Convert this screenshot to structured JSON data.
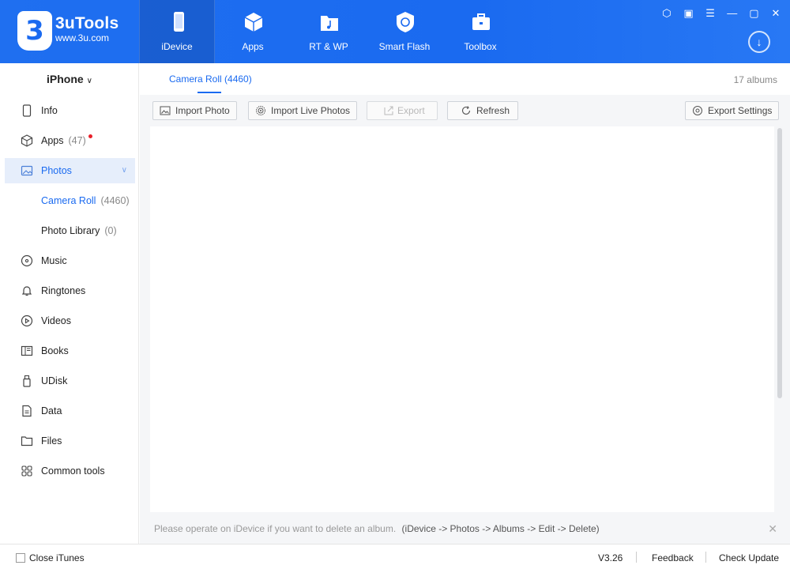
{
  "app": {
    "name": "3uTools",
    "url": "www.3u.com",
    "logo_digit": "3"
  },
  "nav": {
    "tabs": [
      {
        "label": "iDevice",
        "icon": "phone-icon"
      },
      {
        "label": "Apps",
        "icon": "cube-icon"
      },
      {
        "label": "RT & WP",
        "icon": "music-folder-icon"
      },
      {
        "label": "Smart Flash",
        "icon": "flash-cycle-icon"
      },
      {
        "label": "Toolbox",
        "icon": "toolbox-icon"
      }
    ],
    "active": "iDevice"
  },
  "window_controls": [
    "shirt-icon",
    "note-icon",
    "menu-icon",
    "minimize-icon",
    "maximize-icon",
    "close-icon"
  ],
  "device": {
    "name": "iPhone"
  },
  "sidebar": {
    "items": [
      {
        "label": "Info",
        "icon": "phone-outline-icon"
      },
      {
        "label": "Apps",
        "count": "(47)",
        "icon": "cube-outline-icon",
        "badge": true
      },
      {
        "label": "Photos",
        "icon": "picture-icon",
        "active": true
      },
      {
        "label": "Camera Roll",
        "count": "(4460)",
        "sub": true,
        "active": true
      },
      {
        "label": "Photo Library",
        "count": "(0)",
        "sub": true
      },
      {
        "label": "Music",
        "icon": "music-disc-icon"
      },
      {
        "label": "Ringtones",
        "icon": "bell-icon"
      },
      {
        "label": "Videos",
        "icon": "play-circle-icon"
      },
      {
        "label": "Books",
        "icon": "book-icon"
      },
      {
        "label": "UDisk",
        "icon": "usb-icon"
      },
      {
        "label": "Data",
        "icon": "document-icon"
      },
      {
        "label": "Files",
        "icon": "folder-icon"
      },
      {
        "label": "Common tools",
        "icon": "apps-grid-icon"
      }
    ]
  },
  "main": {
    "tab": "Camera Roll (4460)",
    "albums_count": "17 albums",
    "toolbar": {
      "import_photo": "Import Photo",
      "import_live": "Import Live Photos",
      "export": "Export",
      "refresh": "Refresh",
      "export_settings": "Export Settings"
    },
    "notice": {
      "text": "Please operate on iDevice if you want to delete an album.",
      "path": "(iDevice -> Photos -> Albums -> Edit -> Delete)"
    }
  },
  "statusbar": {
    "close_itunes": "Close iTunes",
    "version": "V3.26",
    "feedback": "Feedback",
    "check_update": "Check Update"
  },
  "colors": {
    "brand": "#1a6af0",
    "badge": "#e8202a"
  }
}
